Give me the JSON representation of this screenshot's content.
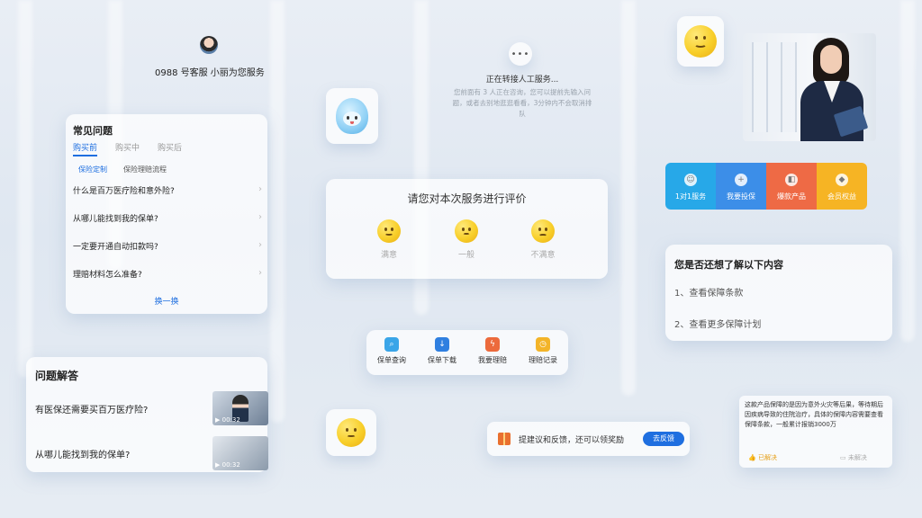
{
  "agent": {
    "line": "0988  号客服 小丽为您服务"
  },
  "faq": {
    "title": "常见问题",
    "tabs": [
      "购买前",
      "购买中",
      "购买后"
    ],
    "subtabs": [
      "保险定制",
      "保险理赔流程"
    ],
    "questions": [
      "什么是百万医疗险和意外险?",
      "从哪儿能找到我的保单?",
      "一定要开通自动扣款吗?",
      "理赔材料怎么准备?"
    ],
    "more": "换一换"
  },
  "qa": {
    "title": "问题解答",
    "items": [
      {
        "question": "有医保还需要买百万医疗险?",
        "duration": "00:32"
      },
      {
        "question": "从哪儿能找到我的保单?",
        "duration": "00:32"
      }
    ]
  },
  "transfer": {
    "title": "正在转接人工服务...",
    "desc": "您前面有 3 人正在咨询，您可以提前先输入问题，或者去别地逛逛看看，3分钟内不会取消排队"
  },
  "rating": {
    "title": "请您对本次服务进行评价",
    "options": [
      "满意",
      "一般",
      "不满意"
    ]
  },
  "services": [
    "保单查询",
    "保单下载",
    "我要理赔",
    "理赔记录"
  ],
  "feedback": {
    "text": "提建议和反馈，还可以领奖励",
    "button": "去反馈"
  },
  "quick": [
    {
      "label": "1对1服务",
      "color": "#27a8e8"
    },
    {
      "label": "我要投保",
      "color": "#3c8ee8"
    },
    {
      "label": "爆款产品",
      "color": "#ee6a45"
    },
    {
      "label": "会员权益",
      "color": "#f6b424"
    }
  ],
  "related": {
    "title": "您是否还想了解以下内容",
    "items": [
      "1、查看保障条款",
      "2、查看更多保障计划"
    ]
  },
  "answer": {
    "text": "这款产品保障的是因为意外火灾等后果，等待期后因疾病导致的住院治疗，具体的保障内容需要查看保障条款，一般累计报销3000万",
    "solved": "已解决",
    "unsolved": "未解决"
  },
  "colors": {
    "accent": "#1f6fe0",
    "emoji": "#f8cf2a"
  }
}
